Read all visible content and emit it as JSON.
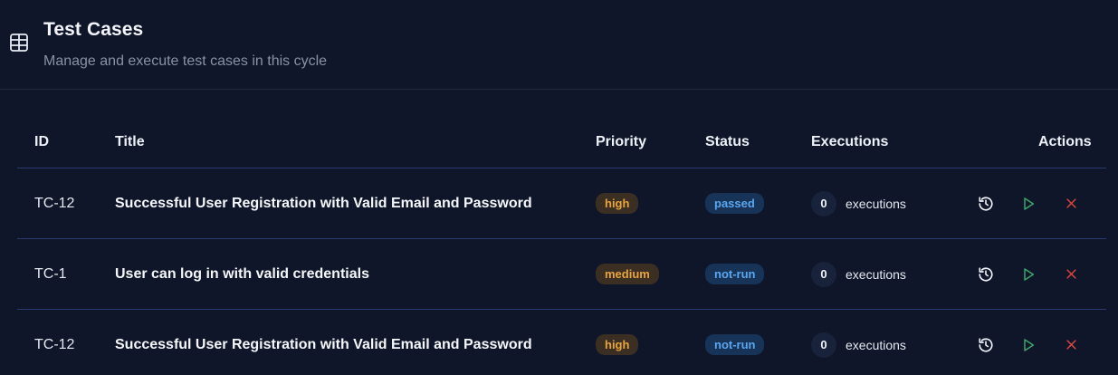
{
  "header": {
    "title": "Test Cases",
    "subtitle": "Manage and execute test cases in this cycle",
    "icon": "table-icon"
  },
  "table": {
    "columns": {
      "id": "ID",
      "title": "Title",
      "priority": "Priority",
      "status": "Status",
      "executions": "Executions",
      "actions": "Actions"
    },
    "rows": [
      {
        "id": "TC-12",
        "title": "Successful User Registration with Valid Email and Password",
        "priority": "high",
        "status": "passed",
        "executions_count": "0",
        "executions_label": "executions"
      },
      {
        "id": "TC-1",
        "title": "User can log in with valid credentials",
        "priority": "medium",
        "status": "not-run",
        "executions_count": "0",
        "executions_label": "executions"
      },
      {
        "id": "TC-12",
        "title": "Successful User Registration with Valid Email and Password",
        "priority": "high",
        "status": "not-run",
        "executions_count": "0",
        "executions_label": "executions"
      }
    ],
    "action_icons": [
      "history-icon",
      "play-icon",
      "close-icon"
    ]
  },
  "colors": {
    "background": "#0f1629",
    "priority_badge_bg": "#3a2f22",
    "priority_badge_text": "#e9a43c",
    "status_badge_bg": "#173358",
    "status_badge_text": "#5aa7f0",
    "play_icon": "#3fa66b",
    "close_icon": "#d9453f",
    "row_divider": "#2a3a6e"
  }
}
